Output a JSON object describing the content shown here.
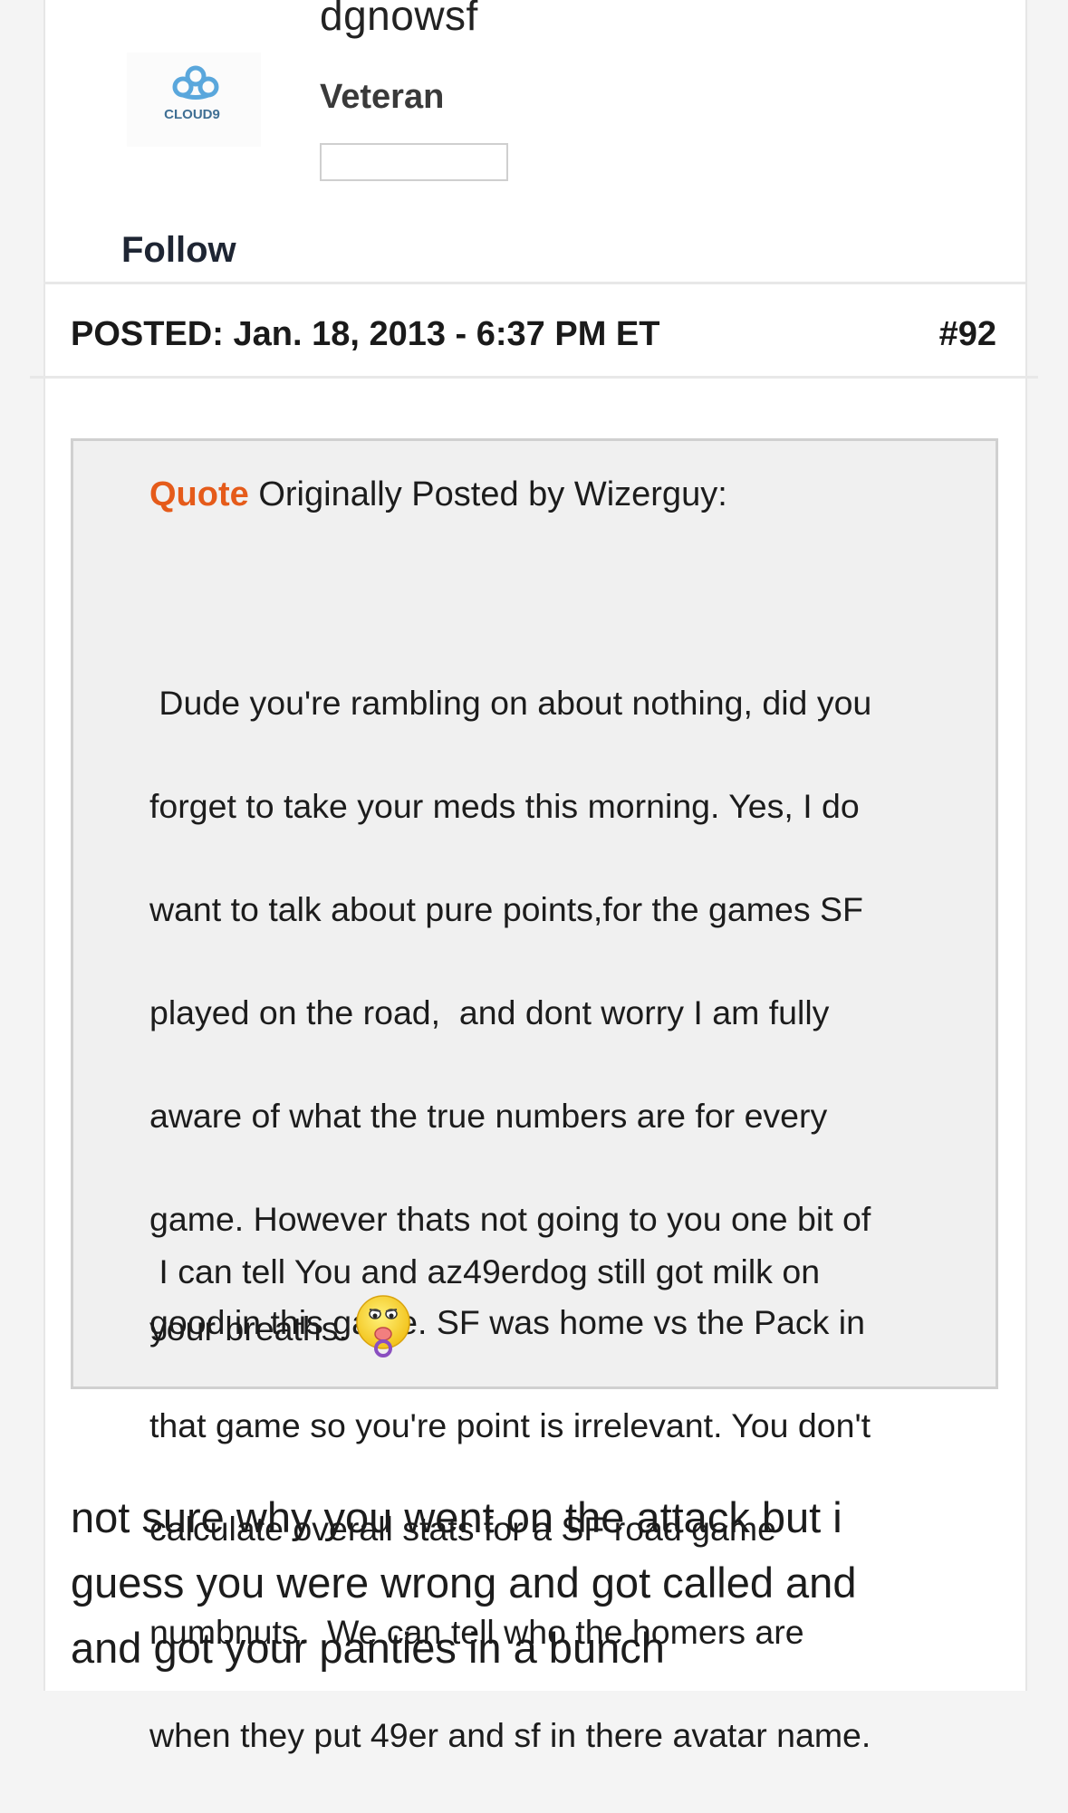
{
  "author": {
    "username": "dgnowsf",
    "rank": "Veteran",
    "avatar_text": "CLOUD9",
    "follow_label": "Follow"
  },
  "post": {
    "posted_label": "POSTED:",
    "posted_date": "Jan. 18, 2013 - 6:37 PM ET",
    "number": "#92"
  },
  "quote": {
    "label": "Quote",
    "header": "Originally Posted by Wizerguy:",
    "body_lines": [
      " Dude you're rambling on about nothing, did you",
      "forget to take your meds this morning. Yes, I do",
      "want to talk about pure points,for the games SF",
      "played on the road,  and dont worry I am fully",
      "aware of what the true numbers are for every",
      "game. However thats not going to you one bit of",
      "good in this game. SF was home vs the Pack in",
      "that game so you're point is irrelevant. You don't",
      "calculate overall stats for a SF road game",
      "numbnuts.  We can tell who the homers are",
      "when they put 49er and sf in there avatar name."
    ],
    "second_para_line1": " I can tell You and az49erdog still got milk on",
    "second_para_line2": "your breaths.",
    "emoji": "pacifier-smiley-icon"
  },
  "reply": {
    "lines": [
      "not sure why you went on the attack but i",
      "guess you were wrong and got called and",
      "and got your panties in a bunch"
    ]
  },
  "colors": {
    "quote_label": "#e55b1a",
    "quote_bg": "#f0f0f0",
    "avatar_blue": "#5aa7dc"
  }
}
